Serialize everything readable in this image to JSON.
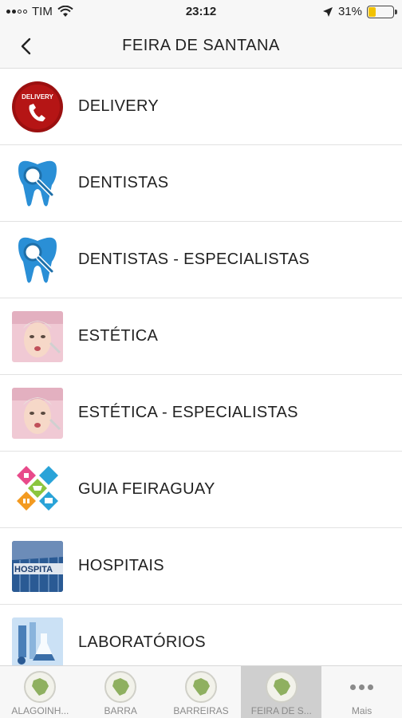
{
  "status_bar": {
    "carrier": "TIM",
    "time": "23:12",
    "battery": "31%",
    "battery_level": 0.31
  },
  "nav": {
    "title": "FEIRA DE SANTANA"
  },
  "items": [
    {
      "label": "DELIVERY",
      "icon": "delivery-phone-icon",
      "badge_text": "DELIVERY"
    },
    {
      "label": "DENTISTAS",
      "icon": "tooth-magnifier-icon"
    },
    {
      "label": "DENTISTAS - ESPECIALISTAS",
      "icon": "tooth-magnifier-icon"
    },
    {
      "label": "ESTÉTICA",
      "icon": "aesthetic-face-photo"
    },
    {
      "label": "ESTÉTICA - ESPECIALISTAS",
      "icon": "aesthetic-face-photo"
    },
    {
      "label": "GUIA FEIRAGUAY",
      "icon": "guide-diamonds-icon"
    },
    {
      "label": "HOSPITAIS",
      "icon": "hospital-building-photo",
      "badge_text": "HOSPITA"
    },
    {
      "label": "LABORATÓRIOS",
      "icon": "laboratory-photo"
    }
  ],
  "tabs": [
    {
      "label": "ALAGOINH...",
      "icon": "brazil-map-icon",
      "active": false
    },
    {
      "label": "BARRA",
      "icon": "brazil-map-icon",
      "active": false
    },
    {
      "label": "BARREIRAS",
      "icon": "brazil-map-icon",
      "active": false
    },
    {
      "label": "FEIRA DE S...",
      "icon": "brazil-map-icon",
      "active": true
    },
    {
      "label": "Mais",
      "icon": "more-dots-icon",
      "active": false
    }
  ],
  "colors": {
    "delivery_red": "#9b1010",
    "tooth_blue": "#2a8fd6",
    "active_tab": "#cfcfcf",
    "map_green": "#8fb060"
  }
}
